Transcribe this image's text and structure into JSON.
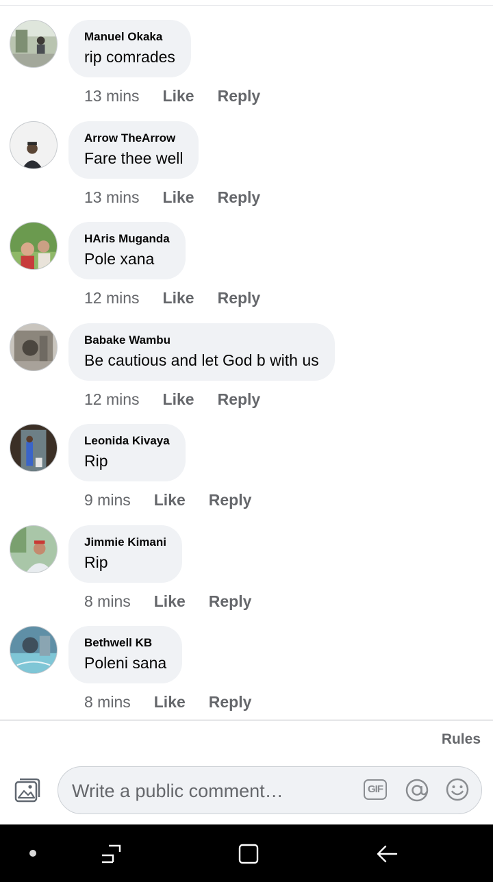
{
  "comments": [
    {
      "author": "Manuel Okaka",
      "text": "rip comrades",
      "time": "13 mins",
      "like": "Like",
      "reply": "Reply"
    },
    {
      "author": "Arrow TheArrow",
      "text": "Fare thee well",
      "time": "13 mins",
      "like": "Like",
      "reply": "Reply"
    },
    {
      "author": "HAris Muganda",
      "text": "Pole xana",
      "time": "12 mins",
      "like": "Like",
      "reply": "Reply"
    },
    {
      "author": "Babake Wambu",
      "text": "Be cautious and let God b with us",
      "time": "12 mins",
      "like": "Like",
      "reply": "Reply"
    },
    {
      "author": "Leonida Kivaya",
      "text": "Rip",
      "time": "9 mins",
      "like": "Like",
      "reply": "Reply"
    },
    {
      "author": "Jimmie Kimani",
      "text": "Rip",
      "time": "8 mins",
      "like": "Like",
      "reply": "Reply"
    },
    {
      "author": "Bethwell KB",
      "text": "Poleni sana",
      "time": "8 mins",
      "like": "Like",
      "reply": "Reply"
    }
  ],
  "footer": {
    "rules": "Rules"
  },
  "composer": {
    "placeholder": "Write a public comment…",
    "gif_label": "GIF"
  },
  "icons": {
    "photo": "photo-icon",
    "gif": "gif-icon",
    "mention": "at-mention-icon",
    "emoji": "emoji-icon",
    "nav_dot": "dot-icon",
    "nav_recent": "recent-apps-icon",
    "nav_home": "home-icon",
    "nav_back": "back-icon"
  },
  "colors": {
    "bubble": "#f0f2f5",
    "meta_text": "#65676b",
    "nav_bar": "#000000"
  }
}
